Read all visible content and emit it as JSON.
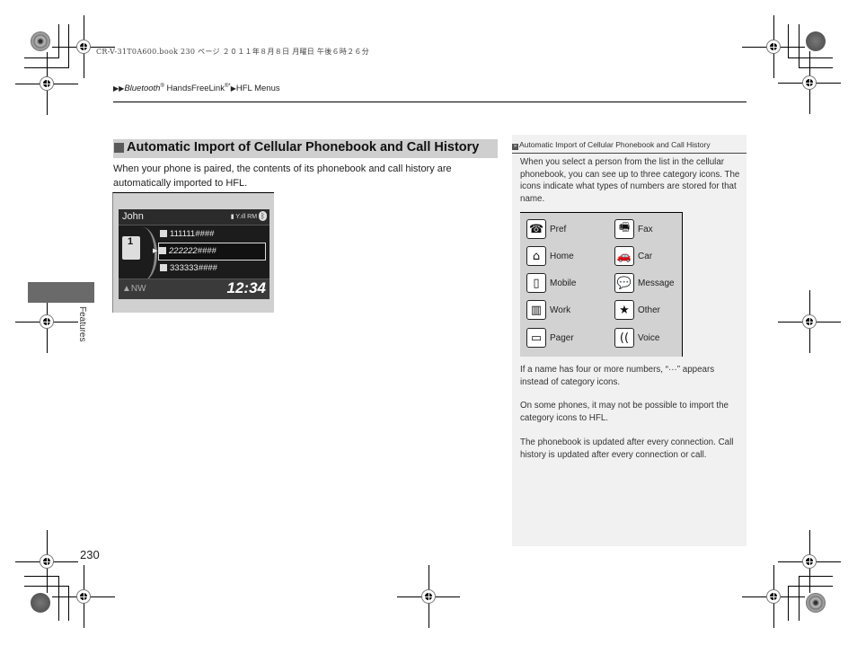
{
  "print_header": "CR-V-31T0A600.book  230 ページ  ２０１１年８月８日  月曜日  午後６時２６分",
  "breadcrumb": {
    "arrows": "▶▶",
    "part1": "Bluetooth",
    "part1_sup": "®",
    "part2": " HandsFreeLink",
    "part2_sup": "®*",
    "sep": "▶",
    "part3": "HFL Menus"
  },
  "section": {
    "title": "Automatic Import of Cellular Phonebook and Call History",
    "body": "When your phone is paired, the contents of its phonebook and call history are automatically imported to HFL."
  },
  "hfl_screen": {
    "contact_name": "John",
    "status_icons": "▮ Y.ıll RM",
    "bluetooth_icon": "ᛒ",
    "book_number": "1",
    "entries": [
      {
        "icon": "pref-phone-icon",
        "number": "111111",
        "masked": "####"
      },
      {
        "icon": "mobile-icon",
        "number": "222222",
        "masked": "####"
      },
      {
        "icon": "other-star-icon",
        "number": "333333",
        "masked": "####"
      }
    ],
    "selected_marker": "▶",
    "direction": "▲NW",
    "clock": "12:34"
  },
  "side_tab": {
    "label": "Features"
  },
  "page_number": "230",
  "sidebar": {
    "head_icon": "»",
    "head": "Automatic Import of Cellular Phonebook and Call History",
    "intro": "When you select a person from the list in the cellular phonebook, you can see up to three category icons. The icons indicate what types of numbers are stored for that name.",
    "icons": [
      {
        "name": "pref-icon",
        "glyph": "☎",
        "label": "Pref"
      },
      {
        "name": "fax-icon",
        "glyph": "🖷",
        "label": "Fax"
      },
      {
        "name": "home-icon",
        "glyph": "⌂",
        "label": "Home"
      },
      {
        "name": "car-icon",
        "glyph": "🚗",
        "label": "Car"
      },
      {
        "name": "mobile-icon",
        "glyph": "▯",
        "label": "Mobile"
      },
      {
        "name": "message-icon",
        "glyph": "💬",
        "label": "Message"
      },
      {
        "name": "work-icon",
        "glyph": "▥",
        "label": "Work"
      },
      {
        "name": "other-icon",
        "glyph": "★",
        "label": "Other"
      },
      {
        "name": "pager-icon",
        "glyph": "▭",
        "label": "Pager"
      },
      {
        "name": "voice-icon",
        "glyph": "((",
        "label": "Voice"
      }
    ],
    "note1": "If a name has four or more numbers, “···” appears instead of category icons.",
    "note2": "On some phones, it may not be possible to import the category icons to HFL.",
    "note3": "The phonebook is updated after every connection. Call history is updated after every connection or call."
  }
}
